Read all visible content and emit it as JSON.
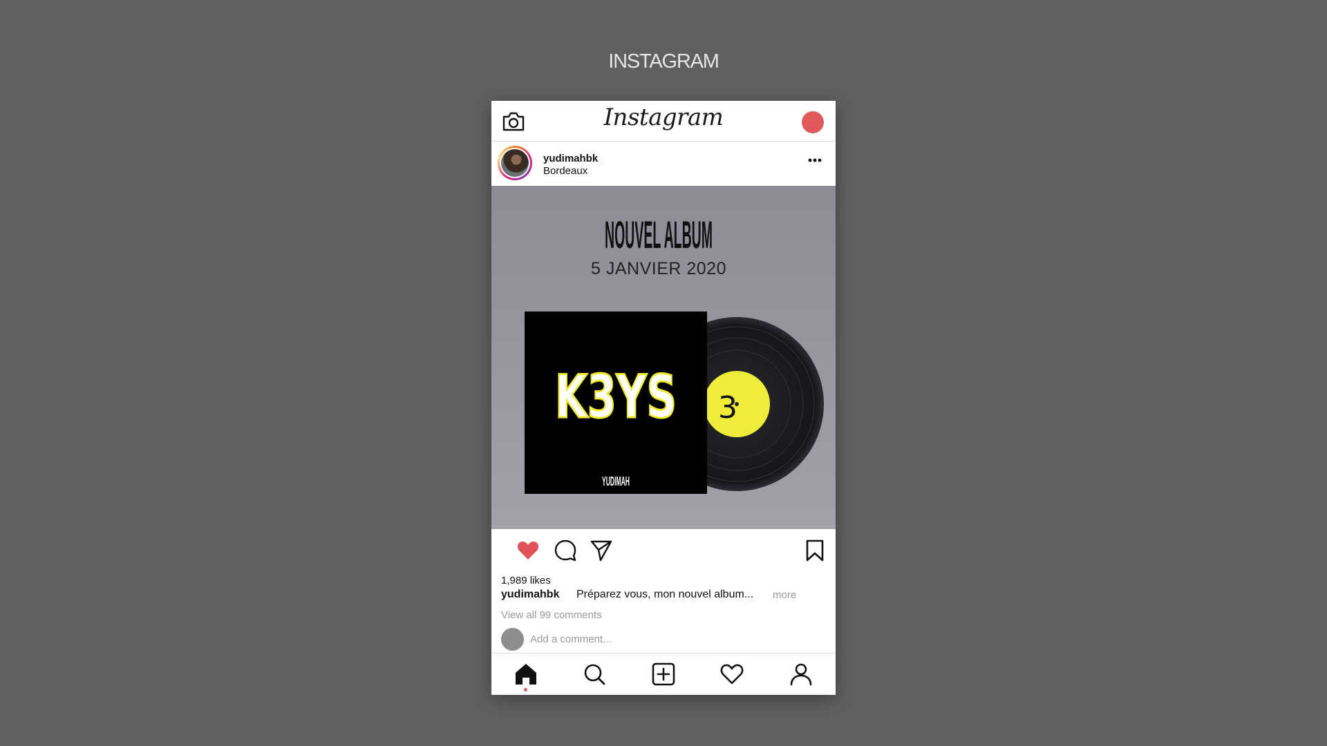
{
  "page": {
    "caption": "INSTAGRAM",
    "background": "#606060"
  },
  "app": {
    "title": "Instagram",
    "record_color": "#e05a5c"
  },
  "post": {
    "username": "yudimahbk",
    "location": "Bordeaux",
    "image": {
      "headline": "NOUVEL ALBUM",
      "date": "5 JANVIER 2020",
      "album_title": "K3YS",
      "artist": "YUDIMAH",
      "label_number": "3"
    },
    "likes": "1,989 likes",
    "caption_user": "yudimahbk",
    "caption_text": "Préparez vous, mon nouvel album...",
    "more_label": "more",
    "view_comments": "View all 99 comments",
    "add_comment_placeholder": "Add a comment..."
  },
  "icons": {
    "camera": "camera-icon",
    "more": "more-options-icon",
    "like": "heart-icon",
    "comment": "comment-icon",
    "share": "send-icon",
    "save": "bookmark-icon",
    "nav": [
      "home-icon",
      "search-icon",
      "add-post-icon",
      "activity-heart-icon",
      "profile-icon"
    ]
  },
  "colors": {
    "liked": "#e0545a",
    "active_dot": "#e0545a"
  }
}
